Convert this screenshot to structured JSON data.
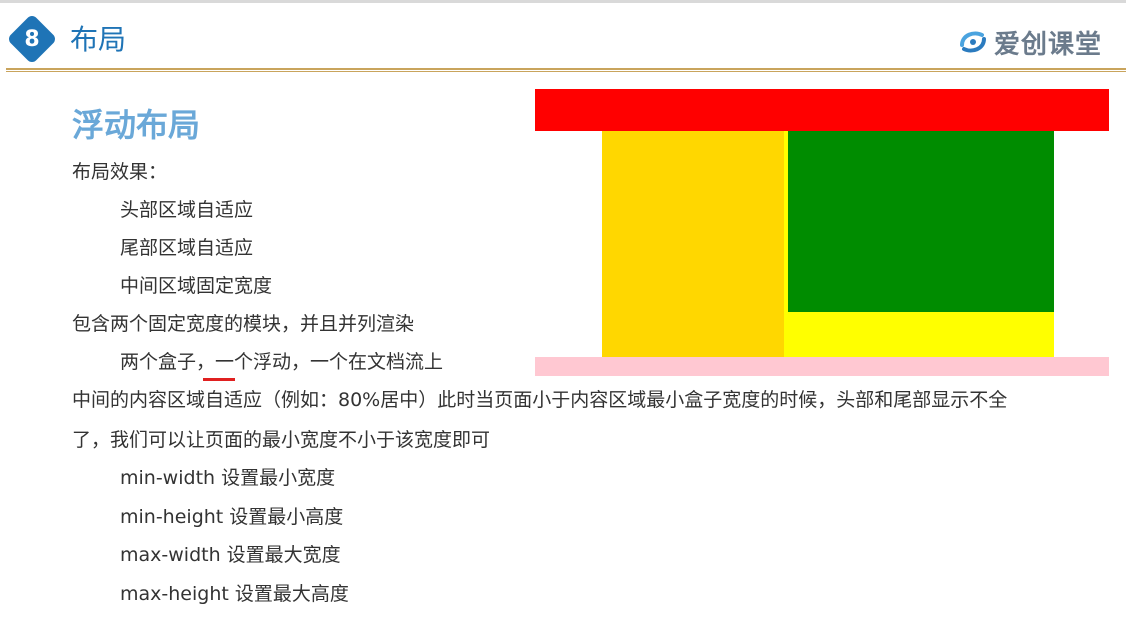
{
  "header": {
    "badge_number": "8",
    "title": "布局",
    "logo_text": "爱创课堂"
  },
  "section": {
    "title": "浮动布局",
    "lines": [
      "布局效果：",
      "头部区域自适应",
      "尾部区域自适应",
      "中间区域固定宽度",
      "包含两个固定宽度的模块，并且并列渲染",
      "两个盒子，一个浮动，一个在文档流上",
      "中间的内容区域自适应（例如：80%居中）此时当页面小于内容区域最小盒子宽度的时候，头部和尾部显示不全",
      "了，我们可以让页面的最小宽度不小于该宽度即可",
      "min-width 设置最小宽度",
      "min-height 设置最小高度",
      "max-width 设置最大宽度",
      "max-height 设置最大高度"
    ]
  },
  "diagram": {
    "colors": {
      "header": "#ff0000",
      "middle": "#ffff00",
      "left_box": "#ffd700",
      "right_box": "#008c00",
      "footer": "#ffc8d2"
    }
  },
  "colors": {
    "accent": "#1f74b6",
    "section_title": "#6aa8d8",
    "rule": "#c9a45c",
    "underline": "#e02020"
  }
}
